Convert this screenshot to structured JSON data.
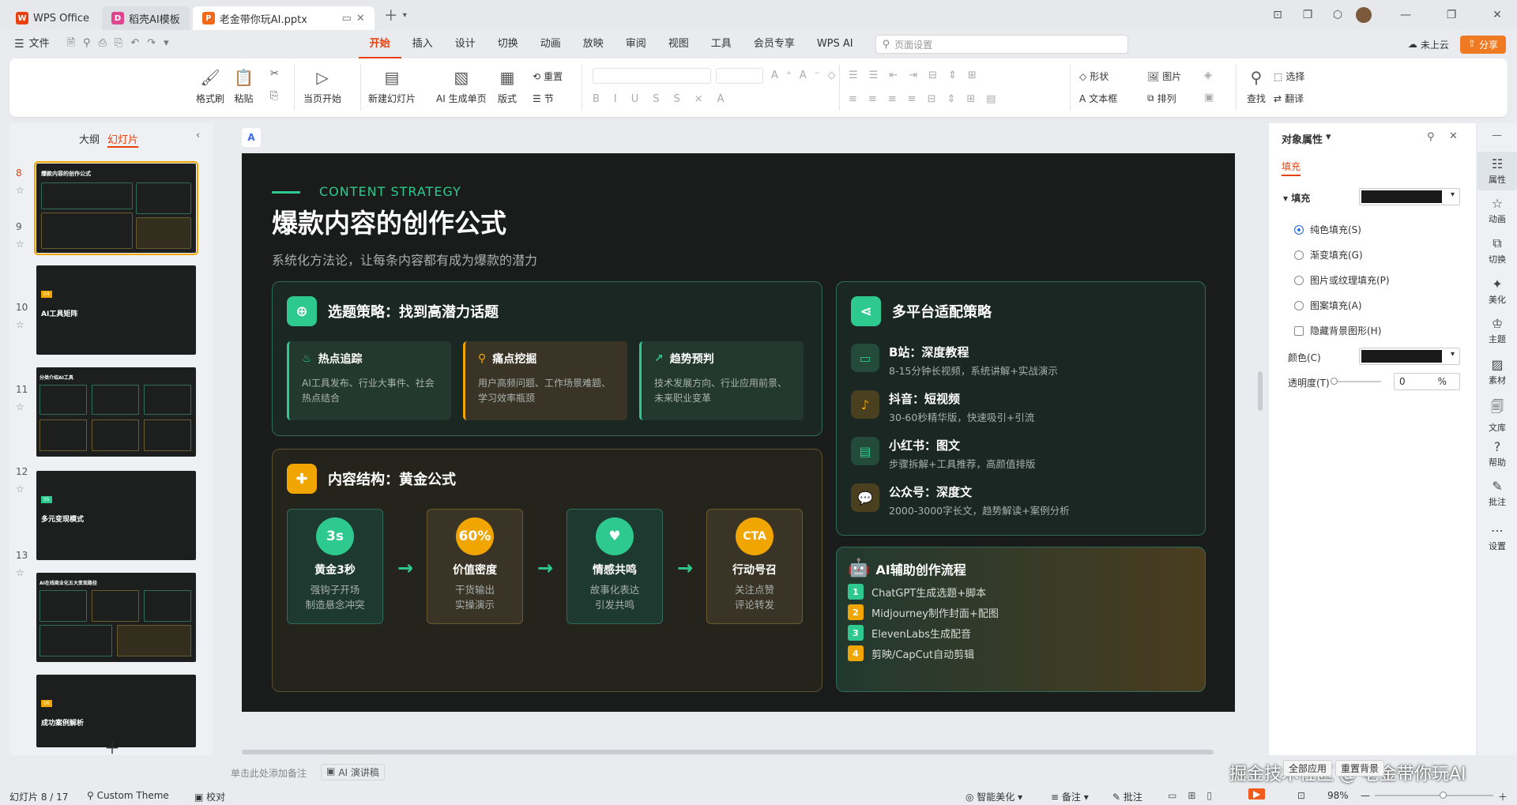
{
  "titlebar": {
    "tabs": [
      {
        "label": "WPS Office",
        "icon": "wps-logo"
      },
      {
        "label": "稻壳AI模板",
        "icon": "docer-logo"
      },
      {
        "label": "老金带你玩AI.pptx",
        "icon": "ppt-logo"
      }
    ]
  },
  "menubar": {
    "file": "文件",
    "items": [
      "开始",
      "插入",
      "设计",
      "切换",
      "动画",
      "放映",
      "审阅",
      "视图",
      "工具",
      "会员专享",
      "WPS AI"
    ],
    "search_placeholder": "页面设置",
    "cloud": "未上云",
    "share": "分享"
  },
  "ribbon": {
    "format_painter": "格式刷",
    "paste": "粘贴",
    "start_from_current": "当页开始",
    "new_slide": "新建幻灯片",
    "ai_generate": "AI 生成单页",
    "layout": "版式",
    "reset": "重置",
    "section": "节",
    "shape": "形状",
    "picture": "图片",
    "textbox": "文本框",
    "arrange": "排列",
    "find": "查找",
    "select": "选择",
    "translate": "翻译"
  },
  "leftpanel": {
    "tab_outline": "大纲",
    "tab_slides": "幻灯片",
    "slides": [
      {
        "num": "8",
        "title": "爆款内容的创作公式"
      },
      {
        "num": "9",
        "title": "AI工具矩阵",
        "badge": "04"
      },
      {
        "num": "10",
        "title": "分类介绍AI工具"
      },
      {
        "num": "11",
        "title": "多元变现模式",
        "badge": "05"
      },
      {
        "num": "12",
        "title": "AI在线商业化五大变现路径"
      },
      {
        "num": "13",
        "title": "成功案例解析",
        "badge": "06"
      }
    ]
  },
  "slide": {
    "eyebrow": "CONTENT STRATEGY",
    "title": "爆款内容的创作公式",
    "subtitle": "系统化方法论，让每条内容都有成为爆款的潜力",
    "topic": {
      "title": "选题策略：找到高潜力话题",
      "cards": [
        {
          "title": "热点追踪",
          "desc": "AI工具发布、行业大事件、社会热点结合",
          "icon": "fire-icon"
        },
        {
          "title": "痛点挖掘",
          "desc": "用户高频问题、工作场景难题、学习效率瓶颈",
          "icon": "search-icon"
        },
        {
          "title": "趋势预判",
          "desc": "技术发展方向、行业应用前景、未来职业变革",
          "icon": "trend-icon"
        }
      ]
    },
    "structure": {
      "title": "内容结构：黄金公式",
      "steps": [
        {
          "badge": "3s",
          "title": "黄金3秒",
          "line1": "强钩子开场",
          "line2": "制造悬念冲突"
        },
        {
          "badge": "60%",
          "title": "价值密度",
          "line1": "干货输出",
          "line2": "实操演示"
        },
        {
          "badge": "♥",
          "title": "情感共鸣",
          "line1": "故事化表达",
          "line2": "引发共鸣"
        },
        {
          "badge": "CTA",
          "title": "行动号召",
          "line1": "关注点赞",
          "line2": "评论转发"
        }
      ]
    },
    "platforms": {
      "title": "多平台适配策略",
      "items": [
        {
          "name": "B站：深度教程",
          "desc": "8-15分钟长视频，系统讲解+实战演示"
        },
        {
          "name": "抖音：短视频",
          "desc": "30-60秒精华版，快速吸引+引流"
        },
        {
          "name": "小红书：图文",
          "desc": "步骤拆解+工具推荐，高颜值排版"
        },
        {
          "name": "公众号：深度文",
          "desc": "2000-3000字长文，趋势解读+案例分析"
        }
      ]
    },
    "ai_flow": {
      "title": "AI辅助创作流程",
      "steps": [
        {
          "n": "1",
          "text": "ChatGPT生成选题+脚本"
        },
        {
          "n": "2",
          "text": "Midjourney制作封面+配图"
        },
        {
          "n": "3",
          "text": "ElevenLabs生成配音"
        },
        {
          "n": "4",
          "text": "剪映/CapCut自动剪辑"
        }
      ]
    }
  },
  "rightpanel": {
    "title": "对象属性",
    "tab": "填充",
    "section": "填充",
    "options": [
      "纯色填充(S)",
      "渐变填充(G)",
      "图片或纹理填充(P)",
      "图案填充(A)"
    ],
    "hide_bg": "隐藏背景图形(H)",
    "color_label": "颜色(C)",
    "opacity_label": "透明度(T)",
    "opacity_value": "0",
    "opacity_unit": "%",
    "apply_all": "全部应用",
    "reset_bg": "重置背景",
    "colors": {
      "fill": "#1a1a1a"
    }
  },
  "sidebar": [
    "属性",
    "动画",
    "切换",
    "美化",
    "主题",
    "素材",
    "文库",
    "帮助",
    "批注",
    "设置"
  ],
  "notes_placeholder": "单击此处添加备注",
  "ai_speech": "AI 演讲稿",
  "watermark": "掘金技术社区 @ 老金带你玩AI",
  "statusbar": {
    "slide_count": "幻灯片 8 / 17",
    "theme": "Custom Theme",
    "proof": "校对",
    "beautify": "智能美化",
    "notes": "备注",
    "comments": "批注",
    "zoom": "98%"
  }
}
